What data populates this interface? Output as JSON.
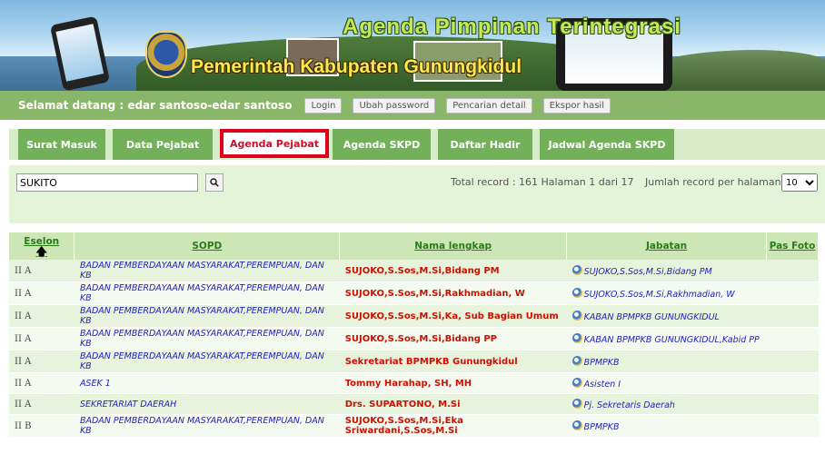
{
  "banner": {
    "title": "Agenda Pimpinan Terintegrasi",
    "subtitle": "Pemerintah Kabupaten Gunungkidul"
  },
  "welcome": {
    "message": "Selamat datang : edar santoso-edar santoso",
    "buttons": [
      "Login",
      "Ubah password",
      "Pencarian detail",
      "Ekspor hasil"
    ]
  },
  "tabs": [
    "Surat Masuk",
    "Data Pejabat",
    "Agenda Pejabat",
    "Agenda SKPD",
    "Daftar Hadir",
    "Jadwal Agenda SKPD"
  ],
  "active_tab": "Agenda Pejabat",
  "search": {
    "value": "SUKITO",
    "total_info": "Total record : 161  Halaman 1 dari 17",
    "per_page_label": "Jumlah record per halaman:",
    "per_page_value": "10"
  },
  "table": {
    "headers": {
      "eselon": "Eselon",
      "sopd": "SOPD",
      "nama": "Nama lengkap",
      "jabatan": "Jabatan",
      "foto": "Pas Foto"
    },
    "rows": [
      {
        "eselon": "II A",
        "sopd": "BADAN PEMBERDAYAAN MASYARAKAT,PEREMPUAN, DAN KB",
        "nama": "SUJOKO,S.Sos,M.Si,Bidang PM",
        "jabatan": "SUJOKO,S.Sos,M.Si,Bidang PM"
      },
      {
        "eselon": "II A",
        "sopd": "BADAN PEMBERDAYAAN MASYARAKAT,PEREMPUAN, DAN KB",
        "nama": "SUJOKO,S.Sos,M.Si,Rakhmadian, W",
        "jabatan": "SUJOKO,S.Sos,M.Si,Rakhmadian, W"
      },
      {
        "eselon": "II A",
        "sopd": "BADAN PEMBERDAYAAN MASYARAKAT,PEREMPUAN, DAN KB",
        "nama": "SUJOKO,S.Sos,M.Si,Ka, Sub Bagian Umum",
        "jabatan": "KABAN BPMPKB GUNUNGKIDUL"
      },
      {
        "eselon": "II A",
        "sopd": "BADAN PEMBERDAYAAN MASYARAKAT,PEREMPUAN, DAN KB",
        "nama": "SUJOKO,S.Sos,M.Si,Bidang PP",
        "jabatan": "KABAN BPMPKB GUNUNGKIDUL,Kabid PP"
      },
      {
        "eselon": "II A",
        "sopd": "BADAN PEMBERDAYAAN MASYARAKAT,PEREMPUAN, DAN KB",
        "nama": "Sekretariat BPMPKB Gunungkidul",
        "jabatan": "BPMPKB"
      },
      {
        "eselon": "II A",
        "sopd": "ASEK 1",
        "nama": "Tommy Harahap, SH, MH",
        "jabatan": "Asisten I"
      },
      {
        "eselon": "II A",
        "sopd": "SEKRETARIAT DAERAH",
        "nama": "Drs. SUPARTONO, M.Si",
        "jabatan": "Pj. Sekretaris Daerah"
      },
      {
        "eselon": "II B",
        "sopd": "BADAN PEMBERDAYAAN MASYARAKAT,PEREMPUAN, DAN KB",
        "nama": "SUJOKO,S.Sos,M.Si,Eka Sriwardani,S.Sos,M.Si",
        "jabatan": "BPMPKB"
      }
    ]
  }
}
